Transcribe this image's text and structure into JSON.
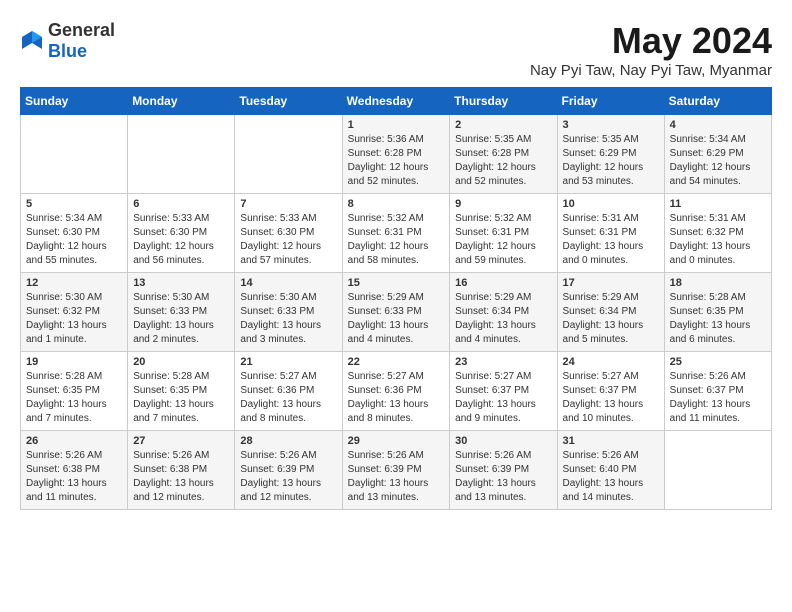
{
  "logo": {
    "general": "General",
    "blue": "Blue"
  },
  "title": "May 2024",
  "location": "Nay Pyi Taw, Nay Pyi Taw, Myanmar",
  "weekdays": [
    "Sunday",
    "Monday",
    "Tuesday",
    "Wednesday",
    "Thursday",
    "Friday",
    "Saturday"
  ],
  "weeks": [
    [
      {
        "day": "",
        "info": ""
      },
      {
        "day": "",
        "info": ""
      },
      {
        "day": "",
        "info": ""
      },
      {
        "day": "1",
        "info": "Sunrise: 5:36 AM\nSunset: 6:28 PM\nDaylight: 12 hours\nand 52 minutes."
      },
      {
        "day": "2",
        "info": "Sunrise: 5:35 AM\nSunset: 6:28 PM\nDaylight: 12 hours\nand 52 minutes."
      },
      {
        "day": "3",
        "info": "Sunrise: 5:35 AM\nSunset: 6:29 PM\nDaylight: 12 hours\nand 53 minutes."
      },
      {
        "day": "4",
        "info": "Sunrise: 5:34 AM\nSunset: 6:29 PM\nDaylight: 12 hours\nand 54 minutes."
      }
    ],
    [
      {
        "day": "5",
        "info": "Sunrise: 5:34 AM\nSunset: 6:30 PM\nDaylight: 12 hours\nand 55 minutes."
      },
      {
        "day": "6",
        "info": "Sunrise: 5:33 AM\nSunset: 6:30 PM\nDaylight: 12 hours\nand 56 minutes."
      },
      {
        "day": "7",
        "info": "Sunrise: 5:33 AM\nSunset: 6:30 PM\nDaylight: 12 hours\nand 57 minutes."
      },
      {
        "day": "8",
        "info": "Sunrise: 5:32 AM\nSunset: 6:31 PM\nDaylight: 12 hours\nand 58 minutes."
      },
      {
        "day": "9",
        "info": "Sunrise: 5:32 AM\nSunset: 6:31 PM\nDaylight: 12 hours\nand 59 minutes."
      },
      {
        "day": "10",
        "info": "Sunrise: 5:31 AM\nSunset: 6:31 PM\nDaylight: 13 hours\nand 0 minutes."
      },
      {
        "day": "11",
        "info": "Sunrise: 5:31 AM\nSunset: 6:32 PM\nDaylight: 13 hours\nand 0 minutes."
      }
    ],
    [
      {
        "day": "12",
        "info": "Sunrise: 5:30 AM\nSunset: 6:32 PM\nDaylight: 13 hours\nand 1 minute."
      },
      {
        "day": "13",
        "info": "Sunrise: 5:30 AM\nSunset: 6:33 PM\nDaylight: 13 hours\nand 2 minutes."
      },
      {
        "day": "14",
        "info": "Sunrise: 5:30 AM\nSunset: 6:33 PM\nDaylight: 13 hours\nand 3 minutes."
      },
      {
        "day": "15",
        "info": "Sunrise: 5:29 AM\nSunset: 6:33 PM\nDaylight: 13 hours\nand 4 minutes."
      },
      {
        "day": "16",
        "info": "Sunrise: 5:29 AM\nSunset: 6:34 PM\nDaylight: 13 hours\nand 4 minutes."
      },
      {
        "day": "17",
        "info": "Sunrise: 5:29 AM\nSunset: 6:34 PM\nDaylight: 13 hours\nand 5 minutes."
      },
      {
        "day": "18",
        "info": "Sunrise: 5:28 AM\nSunset: 6:35 PM\nDaylight: 13 hours\nand 6 minutes."
      }
    ],
    [
      {
        "day": "19",
        "info": "Sunrise: 5:28 AM\nSunset: 6:35 PM\nDaylight: 13 hours\nand 7 minutes."
      },
      {
        "day": "20",
        "info": "Sunrise: 5:28 AM\nSunset: 6:35 PM\nDaylight: 13 hours\nand 7 minutes."
      },
      {
        "day": "21",
        "info": "Sunrise: 5:27 AM\nSunset: 6:36 PM\nDaylight: 13 hours\nand 8 minutes."
      },
      {
        "day": "22",
        "info": "Sunrise: 5:27 AM\nSunset: 6:36 PM\nDaylight: 13 hours\nand 8 minutes."
      },
      {
        "day": "23",
        "info": "Sunrise: 5:27 AM\nSunset: 6:37 PM\nDaylight: 13 hours\nand 9 minutes."
      },
      {
        "day": "24",
        "info": "Sunrise: 5:27 AM\nSunset: 6:37 PM\nDaylight: 13 hours\nand 10 minutes."
      },
      {
        "day": "25",
        "info": "Sunrise: 5:26 AM\nSunset: 6:37 PM\nDaylight: 13 hours\nand 11 minutes."
      }
    ],
    [
      {
        "day": "26",
        "info": "Sunrise: 5:26 AM\nSunset: 6:38 PM\nDaylight: 13 hours\nand 11 minutes."
      },
      {
        "day": "27",
        "info": "Sunrise: 5:26 AM\nSunset: 6:38 PM\nDaylight: 13 hours\nand 12 minutes."
      },
      {
        "day": "28",
        "info": "Sunrise: 5:26 AM\nSunset: 6:39 PM\nDaylight: 13 hours\nand 12 minutes."
      },
      {
        "day": "29",
        "info": "Sunrise: 5:26 AM\nSunset: 6:39 PM\nDaylight: 13 hours\nand 13 minutes."
      },
      {
        "day": "30",
        "info": "Sunrise: 5:26 AM\nSunset: 6:39 PM\nDaylight: 13 hours\nand 13 minutes."
      },
      {
        "day": "31",
        "info": "Sunrise: 5:26 AM\nSunset: 6:40 PM\nDaylight: 13 hours\nand 14 minutes."
      },
      {
        "day": "",
        "info": ""
      }
    ]
  ]
}
